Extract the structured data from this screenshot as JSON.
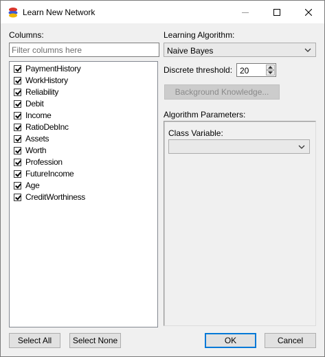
{
  "window": {
    "title": "Learn New Network"
  },
  "columns": {
    "label": "Columns:",
    "filter_placeholder": "Filter columns here",
    "items": [
      {
        "label": "PaymentHistory",
        "checked": true
      },
      {
        "label": "WorkHistory",
        "checked": true
      },
      {
        "label": "Reliability",
        "checked": true
      },
      {
        "label": "Debit",
        "checked": true
      },
      {
        "label": "Income",
        "checked": true
      },
      {
        "label": "RatioDebInc",
        "checked": true
      },
      {
        "label": "Assets",
        "checked": true
      },
      {
        "label": "Worth",
        "checked": true
      },
      {
        "label": "Profession",
        "checked": true
      },
      {
        "label": "FutureIncome",
        "checked": true
      },
      {
        "label": "Age",
        "checked": true
      },
      {
        "label": "CreditWorthiness",
        "checked": true
      }
    ]
  },
  "algorithm": {
    "label": "Learning Algorithm:",
    "selected": "Naive Bayes"
  },
  "threshold": {
    "label": "Discrete threshold:",
    "value": "20"
  },
  "background_knowledge_label": "Background Knowledge...",
  "params": {
    "label": "Algorithm Parameters:",
    "class_variable_label": "Class Variable:",
    "class_variable_value": ""
  },
  "buttons": {
    "select_all": "Select All",
    "select_none": "Select None",
    "ok": "OK",
    "cancel": "Cancel"
  }
}
